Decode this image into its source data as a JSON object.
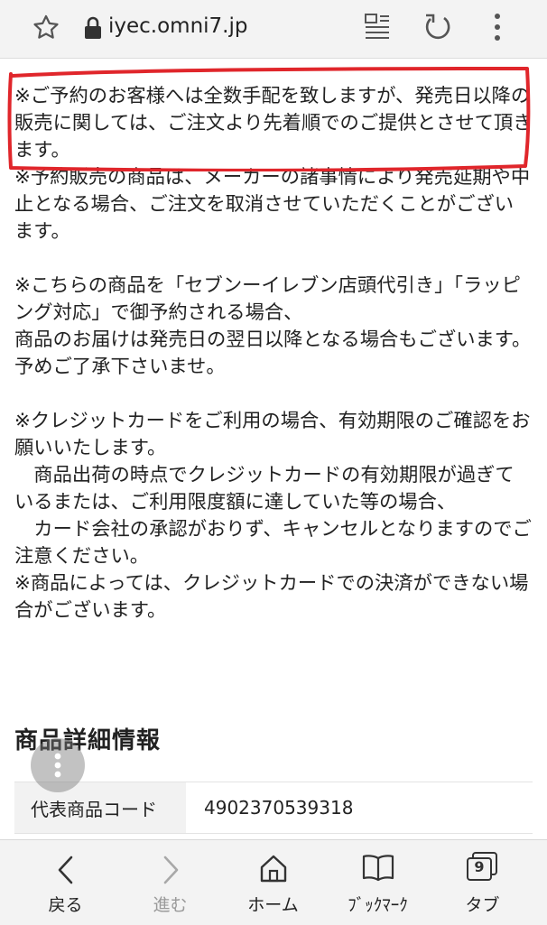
{
  "browser": {
    "url": "iyec.omni7.jp",
    "icons": {
      "bookmark_star": "star-icon",
      "lock": "lock-icon",
      "reader": "reader-mode-icon",
      "reload": "reload-icon",
      "menu": "more-vert-icon"
    }
  },
  "content": {
    "paragraphs": [
      "※ご予約のお客様へは全数手配を致しますが、発売日以降の販売に関しては、ご注文より先着順でのご提供とさせて頂きます。",
      "※予約販売の商品は、メーカーの諸事情により発売延期や中止となる場合、ご注文を取消させていただくことがございます。",
      "",
      "※こちらの商品を「セブンーイレブン店頭代引き」「ラッピング対応」で御予約される場合、\n商品のお届けは発売日の翌日以降となる場合もございます。予めご了承下さいませ。",
      "",
      "※クレジットカードをご利用の場合、有効期限のご確認をお願いいたします。\n　商品出荷の時点でクレジットカードの有効期限が過ぎているまたは、ご利用限度額に達していた等の場合、\n　カード会社の承認がおりず、キャンセルとなりますのでご注意ください。",
      "※商品によっては、クレジットカードでの決済ができない場合がございます。"
    ],
    "highlight_color": "#e0262b"
  },
  "details": {
    "title": "商品詳細情報",
    "rows": [
      {
        "label": "代表商品コード",
        "value": "4902370539318"
      }
    ]
  },
  "bottom_nav": {
    "back": "戻る",
    "forward": "進む",
    "home": "ホーム",
    "bookmarks": "ﾌﾞｯｸﾏｰｸ",
    "tabs": "タブ",
    "tab_count": "9"
  }
}
